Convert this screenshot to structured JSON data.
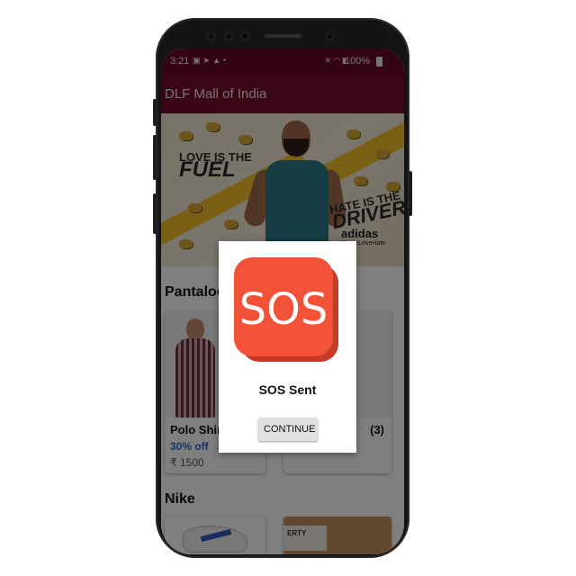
{
  "status_bar": {
    "time": "3:21",
    "left_icons": [
      "image-icon",
      "telegram-icon",
      "notification-icon",
      "dot-icon"
    ],
    "right_icons": [
      "mute-icon",
      "wifi-icon",
      "volte-icon",
      "signal-icon"
    ],
    "network_label": "VoLTE LTE1",
    "battery": "100%"
  },
  "app_bar": {
    "title": "DLF Mall of India"
  },
  "banner": {
    "left_text_small": "LOVE IS THE",
    "left_text_big": "FUEL",
    "right_text_small": "HATE IS THE",
    "right_text_big": "DRIVER",
    "brand": "adidas",
    "hashtag": "#LoveLoveHate"
  },
  "sections": [
    {
      "title": "Pantaloons",
      "products": [
        {
          "name": "Polo Shirt",
          "discount": "30% off",
          "price": "₹ 1500"
        },
        {
          "name": "(3)"
        }
      ]
    },
    {
      "title": "Nike",
      "box_label": "ERTY"
    }
  ],
  "dialog": {
    "logo_text": "SOS",
    "title": "SOS Sent",
    "button_label": "CONTINUE"
  },
  "colors": {
    "status_bar": "#6b0829",
    "app_bar": "#770a30",
    "sos_red": "#f25237",
    "sos_dark": "#c73a25",
    "discount_blue": "#2c6fd1"
  }
}
